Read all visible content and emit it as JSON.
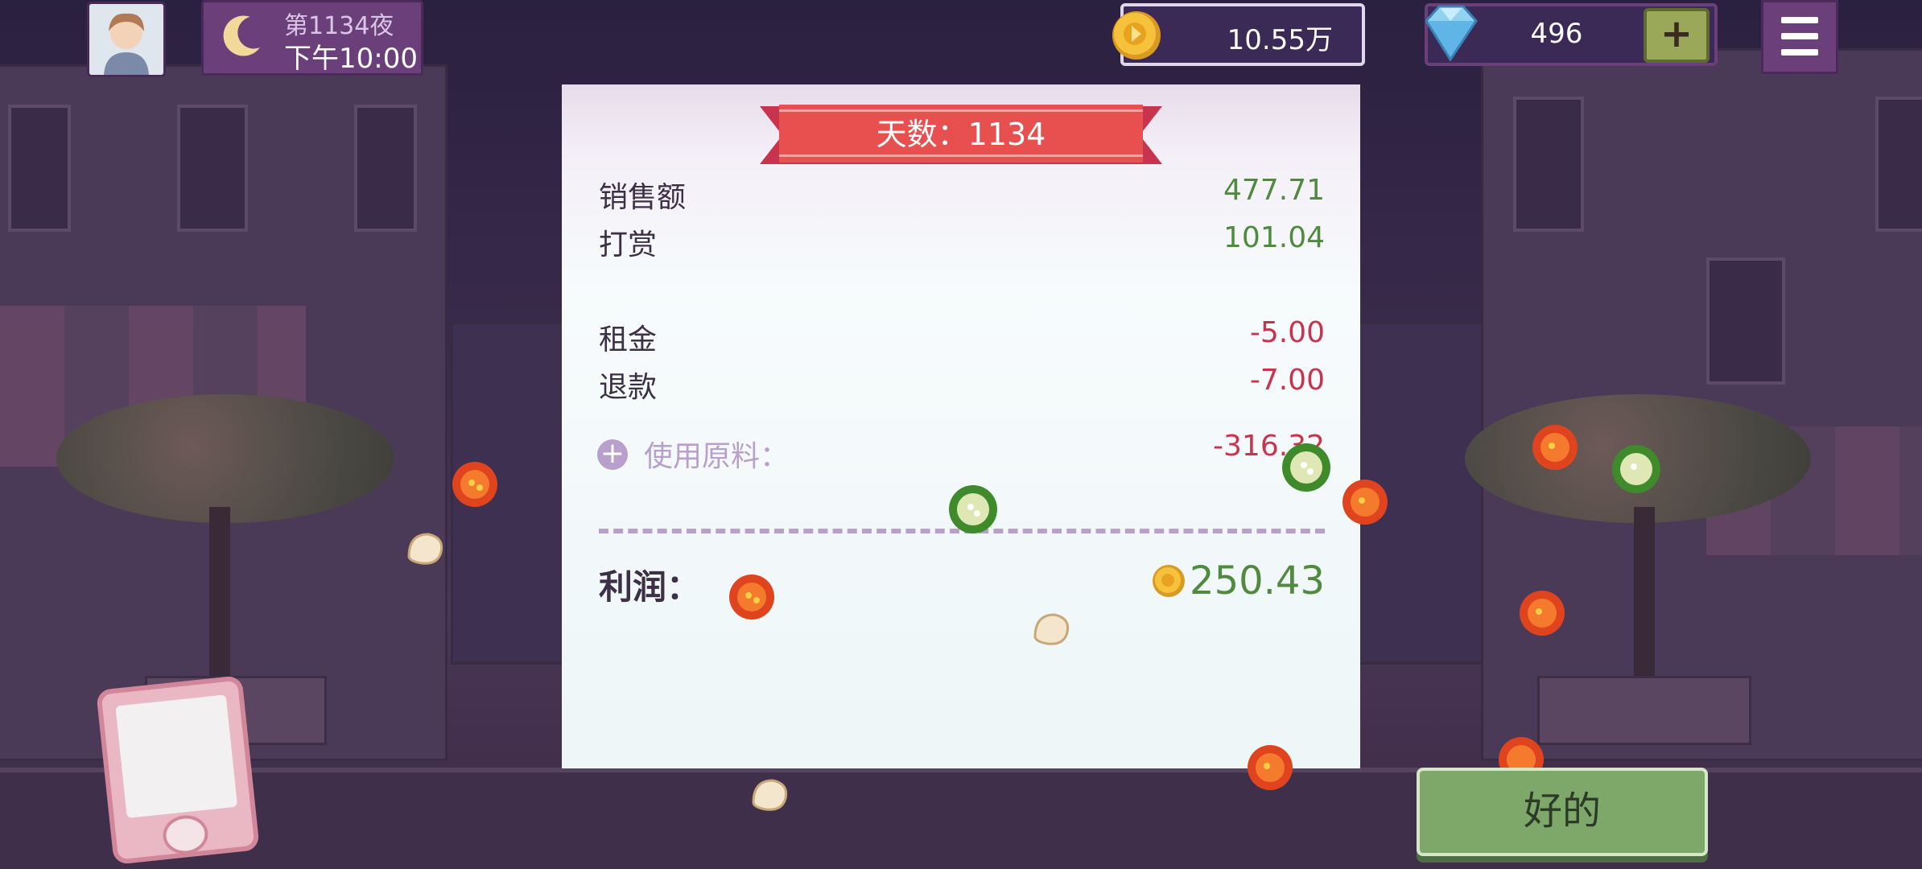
{
  "hud": {
    "night_label": "第1134夜",
    "time_label": "下午10:00",
    "coins": "10.55万",
    "gems": "496",
    "add_gems_label": "+"
  },
  "receipt": {
    "banner": "天数：1134",
    "sales_label": "销售额",
    "sales_value": "477.71",
    "tips_label": "打赏",
    "tips_value": "101.04",
    "rent_label": "租金",
    "rent_value": "-5.00",
    "refund_label": "退款",
    "refund_value": "-7.00",
    "ingredients_label": "使用原料：",
    "ingredients_value": "-316.32",
    "profit_label": "利润：",
    "profit_value": "250.43"
  },
  "actions": {
    "ok_label": "好的"
  },
  "icons": {
    "moon": "moon-icon",
    "coin": "coin-icon",
    "gem": "gem-icon",
    "menu": "hamburger-menu-icon"
  },
  "colors": {
    "positive": "#4f8a3e",
    "negative": "#c8344e",
    "banner": "#e8504f",
    "accent_purple": "#6b3f7a",
    "ok_button": "#7ea86a"
  }
}
